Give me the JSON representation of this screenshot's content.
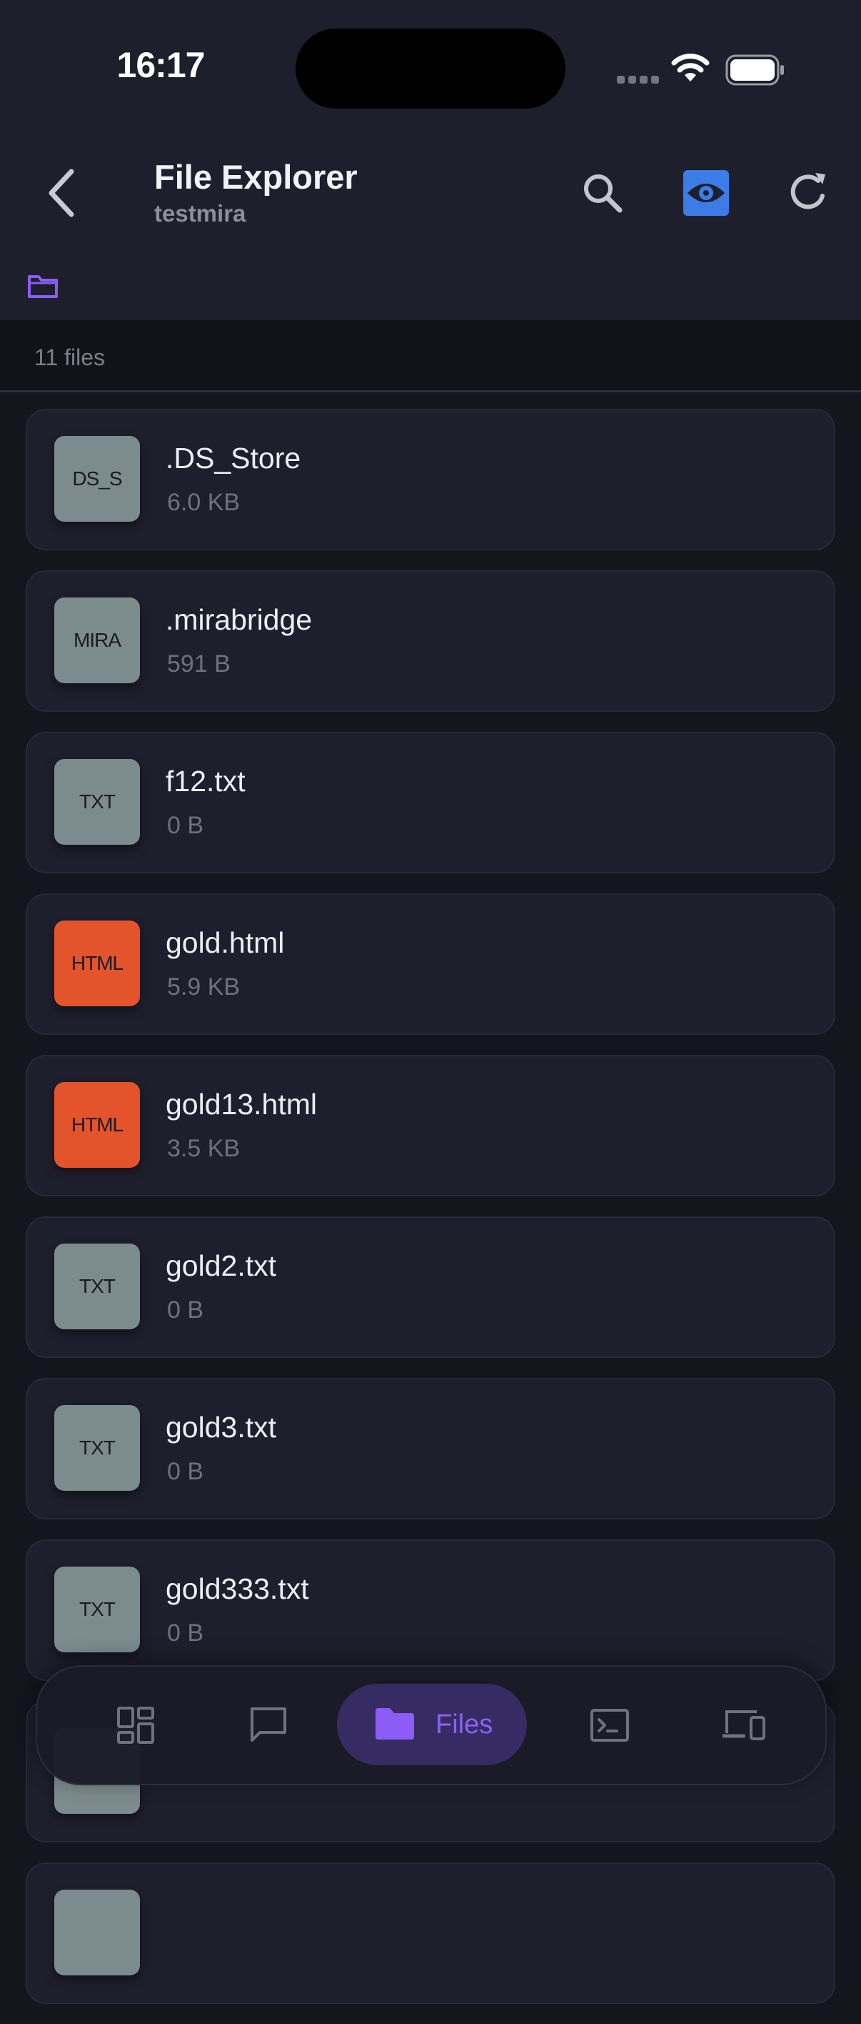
{
  "status_bar": {
    "time": "16:17"
  },
  "header": {
    "title": "File Explorer",
    "subtitle": "testmira",
    "accent": "#3d7be6"
  },
  "summary": {
    "count_label": "11 files"
  },
  "files": [
    {
      "badge": "DS_S",
      "name": ".DS_Store",
      "size": "6.0 KB",
      "type": "generic"
    },
    {
      "badge": "MIRA",
      "name": ".mirabridge",
      "size": "591 B",
      "type": "generic"
    },
    {
      "badge": "TXT",
      "name": "f12.txt",
      "size": "0 B",
      "type": "generic"
    },
    {
      "badge": "HTML",
      "name": "gold.html",
      "size": "5.9 KB",
      "type": "html"
    },
    {
      "badge": "HTML",
      "name": "gold13.html",
      "size": "3.5 KB",
      "type": "html"
    },
    {
      "badge": "TXT",
      "name": "gold2.txt",
      "size": "0 B",
      "type": "generic"
    },
    {
      "badge": "TXT",
      "name": "gold3.txt",
      "size": "0 B",
      "type": "generic"
    },
    {
      "badge": "TXT",
      "name": "gold333.txt",
      "size": "0 B",
      "type": "generic"
    },
    {
      "badge": "",
      "name": "",
      "size": "",
      "type": "generic"
    },
    {
      "badge": "",
      "name": "",
      "size": "",
      "type": "generic"
    }
  ],
  "bottom_nav": {
    "items": [
      {
        "icon": "dashboard-icon"
      },
      {
        "icon": "chat-icon"
      },
      {
        "icon": "folder-icon",
        "label": "Files",
        "active": true
      },
      {
        "icon": "terminal-icon"
      },
      {
        "icon": "devices-icon"
      }
    ]
  },
  "colors": {
    "background": "#14151d",
    "header_bg": "#1e1f2c",
    "html_badge": "#e3542d",
    "generic_badge": "#7c8b8e",
    "nav_active": "#8b62f2"
  }
}
